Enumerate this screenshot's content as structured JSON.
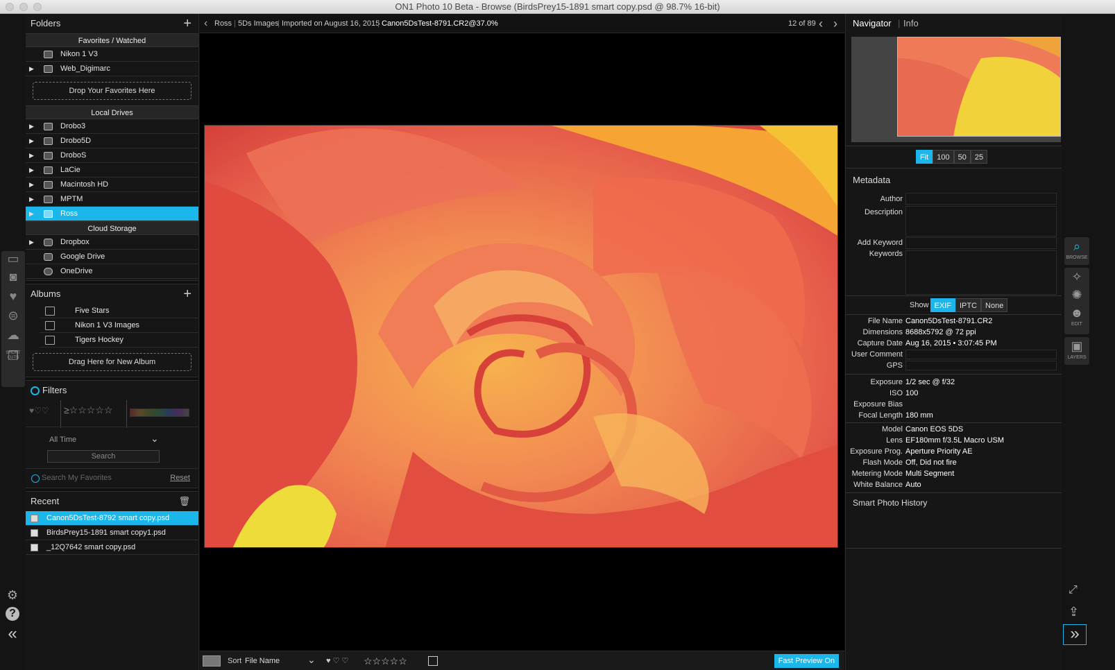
{
  "window": {
    "title": "ON1 Photo 10 Beta - Browse (BirdsPrey15-1891 smart copy.psd @ 98.7% 16-bit)"
  },
  "left_panel": {
    "folders_title": "Folders",
    "favorites_header": "Favorites / Watched",
    "favorites": [
      "Nikon 1 V3",
      "Web_Digimarc"
    ],
    "drop_favorites": "Drop Your Favorites Here",
    "local_header": "Local Drives",
    "local_drives": [
      "Drobo3",
      "Drobo5D",
      "DroboS",
      "LaCie",
      "Macintosh HD",
      "MPTM",
      "Ross"
    ],
    "cloud_header": "Cloud Storage",
    "cloud": [
      "Dropbox",
      "Google Drive",
      "OneDrive"
    ],
    "albums_title": "Albums",
    "albums": [
      "Five Stars",
      "Nikon 1 V3 Images",
      "Tigers Hockey"
    ],
    "drop_album": "Drag Here for New Album",
    "filters_title": "Filters",
    "time_select": "All Time",
    "search_btn": "Search",
    "search_fav": "Search My Favorites",
    "reset": "Reset",
    "recent_title": "Recent",
    "recent": [
      "Canon5DsTest-8792 smart copy.psd",
      "BirdsPrey15-1891 smart copy1.psd",
      "_12Q7642 smart copy.psd"
    ]
  },
  "left_rail": {
    "shortcuts_label": "SHORT CUTS"
  },
  "breadcrumb": {
    "c1": "Ross",
    "c2": "5Ds Images",
    "c3": "Imported on August 16, 2015",
    "c4": "Canon5DsTest-8791.CR2@37.0%",
    "counter": "12 of 89"
  },
  "bottom": {
    "sort_label": "Sort",
    "sort_value": "File Name",
    "fast_preview": "Fast Preview On"
  },
  "right_panel": {
    "tab_navigator": "Navigator",
    "tab_info": "Info",
    "zoom": [
      "Fit",
      "100",
      "50",
      "25"
    ],
    "metadata_title": "Metadata",
    "author_label": "Author",
    "description_label": "Description",
    "add_keyword_label": "Add Keyword",
    "keywords_label": "Keywords",
    "show_label": "Show",
    "show_opts": [
      "EXIF",
      "IPTC",
      "None"
    ],
    "exif": [
      {
        "label": "File Name",
        "value": "Canon5DsTest-8791.CR2"
      },
      {
        "label": "Dimensions",
        "value": "8688x5792 @ 72 ppi"
      },
      {
        "label": "Capture Date",
        "value": "Aug 16, 2015 • 3:07:45 PM"
      },
      {
        "label": "User Comment",
        "value": ""
      },
      {
        "label": "GPS",
        "value": ""
      },
      {
        "label": "Exposure",
        "value": "1/2 sec @ f/32"
      },
      {
        "label": "ISO",
        "value": "100"
      },
      {
        "label": "Exposure Bias",
        "value": ""
      },
      {
        "label": "Focal Length",
        "value": "180 mm"
      },
      {
        "label": "Model",
        "value": "Canon EOS 5DS"
      },
      {
        "label": "Lens",
        "value": "EF180mm f/3.5L Macro USM"
      },
      {
        "label": "Exposure Prog.",
        "value": "Aperture Priority AE"
      },
      {
        "label": "Flash Mode",
        "value": "Off, Did not fire"
      },
      {
        "label": "Metering Mode",
        "value": "Multi Segment"
      },
      {
        "label": "White Balance",
        "value": "Auto"
      }
    ],
    "history_title": "Smart Photo History"
  },
  "right_rail": {
    "browse": "BROWSE",
    "edit": "EDIT",
    "layers": "LAYERS"
  }
}
